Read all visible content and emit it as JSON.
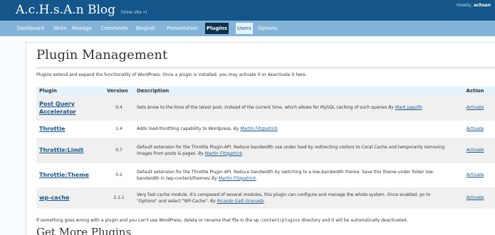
{
  "header": {
    "blog_title": "A.c.H.s.A.n Blog",
    "view_site": "(View site »)",
    "howdy_prefix": "Howdy,",
    "username": "achsan"
  },
  "nav": {
    "items": [
      {
        "label": "Dashboard"
      },
      {
        "label": "Write"
      },
      {
        "label": "Manage"
      },
      {
        "label": "Comments"
      },
      {
        "label": "Blogroll"
      },
      {
        "label": "Presentation"
      },
      {
        "label": "Plugins",
        "active": true
      },
      {
        "label": "Users"
      },
      {
        "label": "Options"
      }
    ]
  },
  "main": {
    "title": "Plugin Management",
    "intro": "Plugins extend and expand the functionality of WordPress. Once a plugin is installed, you may activate it or deactivate it here.",
    "table": {
      "headers": {
        "plugin": "Plugin",
        "version": "Version",
        "description": "Description",
        "action": "Action"
      },
      "rows": [
        {
          "name": "Post Query Accelerator",
          "version": "0.4",
          "description": "Sets $now to the time of the latest post, instead of the current time, which allows for MySQL caching of such queries",
          "by": "By",
          "author": "Mark Jaquith",
          "end": ".",
          "action": "Activate"
        },
        {
          "name": "Throttle",
          "version": "1.4",
          "description": "Adds load-throttling capability to Wordpress.",
          "by": "By",
          "author": "Martin Fitzpatrick",
          "end": ".",
          "action": "Activate"
        },
        {
          "name": "Throttle:Limit",
          "version": "0.7",
          "description": "Default extension for the Throttle Plugin-API. Reduce bandwidth use under load by redirecting visitors to Coral Cache and temporarily removing images from posts & pages.",
          "by": "By",
          "author": "Martin Fitzpatrick",
          "end": ".",
          "action": "Activate"
        },
        {
          "name": "Throttle:Theme",
          "version": "0.2",
          "description": "Default extension for the Throttle Plugin-API. Reduce bandwidth by switching to a low-bandwidth theme. Save this theme under folder low-bandwidth in /wp-content/themes/",
          "by": "By",
          "author": "Martin Fitzpatrick",
          "end": ".",
          "action": "Activate"
        },
        {
          "name": "wp-cache",
          "version": "2.1.1",
          "description": "Very fast cache module. It's composed of several modules, this plugin can configure and manage the whole system. Once enabled, go to \"Options\" and select \"WP-Cache\".",
          "by": "By",
          "author": "Ricardo Galli Granada",
          "end": ".",
          "action": "Activate"
        }
      ]
    },
    "warning_before": "If something goes wrong with a plugin and you can't use WordPress, delete or rename that file in the",
    "warning_code": "wp-content/plugins",
    "warning_after": "directory and it will be automatically deactivated.",
    "more_title": "Get More Plugins"
  }
}
